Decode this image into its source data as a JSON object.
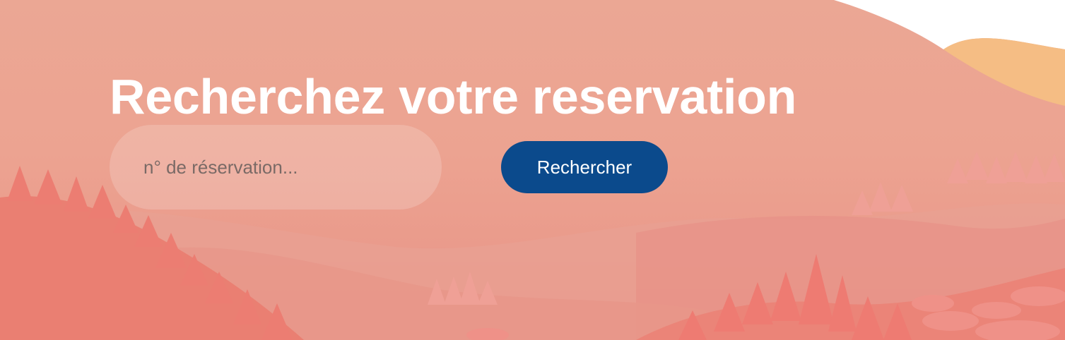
{
  "hero": {
    "title": "Recherchez votre reservation"
  },
  "search": {
    "placeholder": "n° de réservation...",
    "value": "",
    "button_label": "Rechercher"
  },
  "colors": {
    "button_bg": "#0b4a8c",
    "background": "#eca391",
    "sun": "#f5bd84"
  }
}
